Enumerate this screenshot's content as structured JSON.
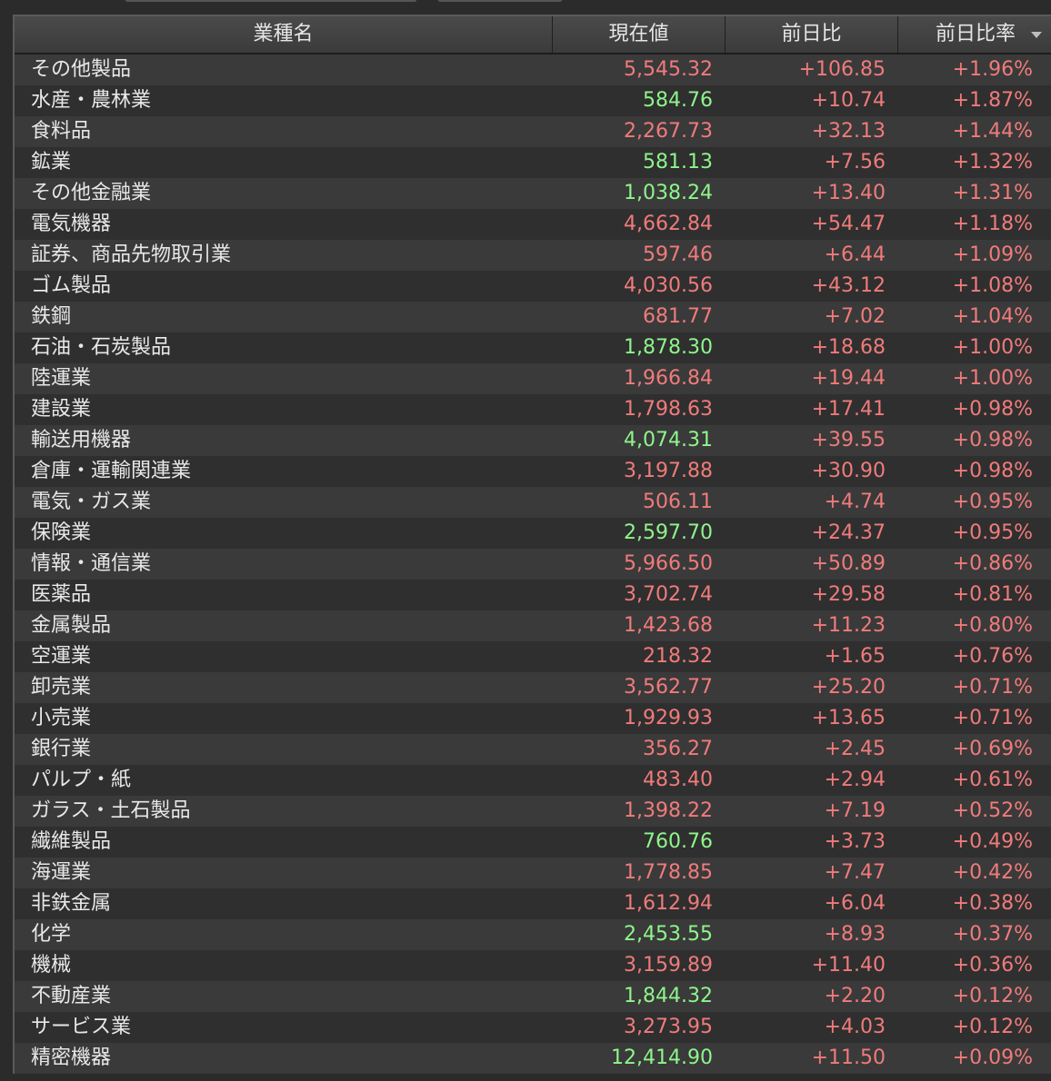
{
  "colors": {
    "up_red": "#f07b7b",
    "up_green": "#8ef58b",
    "header_text": "#e6e6e6",
    "background": "#2b2b2b"
  },
  "header": {
    "name": "業種名",
    "price": "現在値",
    "change": "前日比",
    "change_rate": "前日比率",
    "sort_icon": "sort-descending-icon"
  },
  "rows": [
    {
      "name": "その他製品",
      "price": "5,545.32",
      "price_color": "red",
      "change": "+106.85",
      "rate": "+1.96%"
    },
    {
      "name": "水産・農林業",
      "price": "584.76",
      "price_color": "green",
      "change": "+10.74",
      "rate": "+1.87%"
    },
    {
      "name": "食料品",
      "price": "2,267.73",
      "price_color": "red",
      "change": "+32.13",
      "rate": "+1.44%"
    },
    {
      "name": "鉱業",
      "price": "581.13",
      "price_color": "green",
      "change": "+7.56",
      "rate": "+1.32%"
    },
    {
      "name": "その他金融業",
      "price": "1,038.24",
      "price_color": "green",
      "change": "+13.40",
      "rate": "+1.31%"
    },
    {
      "name": "電気機器",
      "price": "4,662.84",
      "price_color": "red",
      "change": "+54.47",
      "rate": "+1.18%"
    },
    {
      "name": "証券、商品先物取引業",
      "price": "597.46",
      "price_color": "red",
      "change": "+6.44",
      "rate": "+1.09%"
    },
    {
      "name": "ゴム製品",
      "price": "4,030.56",
      "price_color": "red",
      "change": "+43.12",
      "rate": "+1.08%"
    },
    {
      "name": "鉄鋼",
      "price": "681.77",
      "price_color": "red",
      "change": "+7.02",
      "rate": "+1.04%"
    },
    {
      "name": "石油・石炭製品",
      "price": "1,878.30",
      "price_color": "green",
      "change": "+18.68",
      "rate": "+1.00%"
    },
    {
      "name": "陸運業",
      "price": "1,966.84",
      "price_color": "red",
      "change": "+19.44",
      "rate": "+1.00%"
    },
    {
      "name": "建設業",
      "price": "1,798.63",
      "price_color": "red",
      "change": "+17.41",
      "rate": "+0.98%"
    },
    {
      "name": "輸送用機器",
      "price": "4,074.31",
      "price_color": "green",
      "change": "+39.55",
      "rate": "+0.98%"
    },
    {
      "name": "倉庫・運輸関連業",
      "price": "3,197.88",
      "price_color": "red",
      "change": "+30.90",
      "rate": "+0.98%"
    },
    {
      "name": "電気・ガス業",
      "price": "506.11",
      "price_color": "red",
      "change": "+4.74",
      "rate": "+0.95%"
    },
    {
      "name": "保険業",
      "price": "2,597.70",
      "price_color": "green",
      "change": "+24.37",
      "rate": "+0.95%"
    },
    {
      "name": "情報・通信業",
      "price": "5,966.50",
      "price_color": "red",
      "change": "+50.89",
      "rate": "+0.86%"
    },
    {
      "name": "医薬品",
      "price": "3,702.74",
      "price_color": "red",
      "change": "+29.58",
      "rate": "+0.81%"
    },
    {
      "name": "金属製品",
      "price": "1,423.68",
      "price_color": "red",
      "change": "+11.23",
      "rate": "+0.80%"
    },
    {
      "name": "空運業",
      "price": "218.32",
      "price_color": "red",
      "change": "+1.65",
      "rate": "+0.76%"
    },
    {
      "name": "卸売業",
      "price": "3,562.77",
      "price_color": "red",
      "change": "+25.20",
      "rate": "+0.71%"
    },
    {
      "name": "小売業",
      "price": "1,929.93",
      "price_color": "red",
      "change": "+13.65",
      "rate": "+0.71%"
    },
    {
      "name": "銀行業",
      "price": "356.27",
      "price_color": "red",
      "change": "+2.45",
      "rate": "+0.69%"
    },
    {
      "name": "パルプ・紙",
      "price": "483.40",
      "price_color": "red",
      "change": "+2.94",
      "rate": "+0.61%"
    },
    {
      "name": "ガラス・土石製品",
      "price": "1,398.22",
      "price_color": "red",
      "change": "+7.19",
      "rate": "+0.52%"
    },
    {
      "name": "繊維製品",
      "price": "760.76",
      "price_color": "green",
      "change": "+3.73",
      "rate": "+0.49%"
    },
    {
      "name": "海運業",
      "price": "1,778.85",
      "price_color": "red",
      "change": "+7.47",
      "rate": "+0.42%"
    },
    {
      "name": "非鉄金属",
      "price": "1,612.94",
      "price_color": "red",
      "change": "+6.04",
      "rate": "+0.38%"
    },
    {
      "name": "化学",
      "price": "2,453.55",
      "price_color": "green",
      "change": "+8.93",
      "rate": "+0.37%"
    },
    {
      "name": "機械",
      "price": "3,159.89",
      "price_color": "red",
      "change": "+11.40",
      "rate": "+0.36%"
    },
    {
      "name": "不動産業",
      "price": "1,844.32",
      "price_color": "green",
      "change": "+2.20",
      "rate": "+0.12%"
    },
    {
      "name": "サービス業",
      "price": "3,273.95",
      "price_color": "red",
      "change": "+4.03",
      "rate": "+0.12%"
    },
    {
      "name": "精密機器",
      "price": "12,414.90",
      "price_color": "green",
      "change": "+11.50",
      "rate": "+0.09%"
    }
  ]
}
